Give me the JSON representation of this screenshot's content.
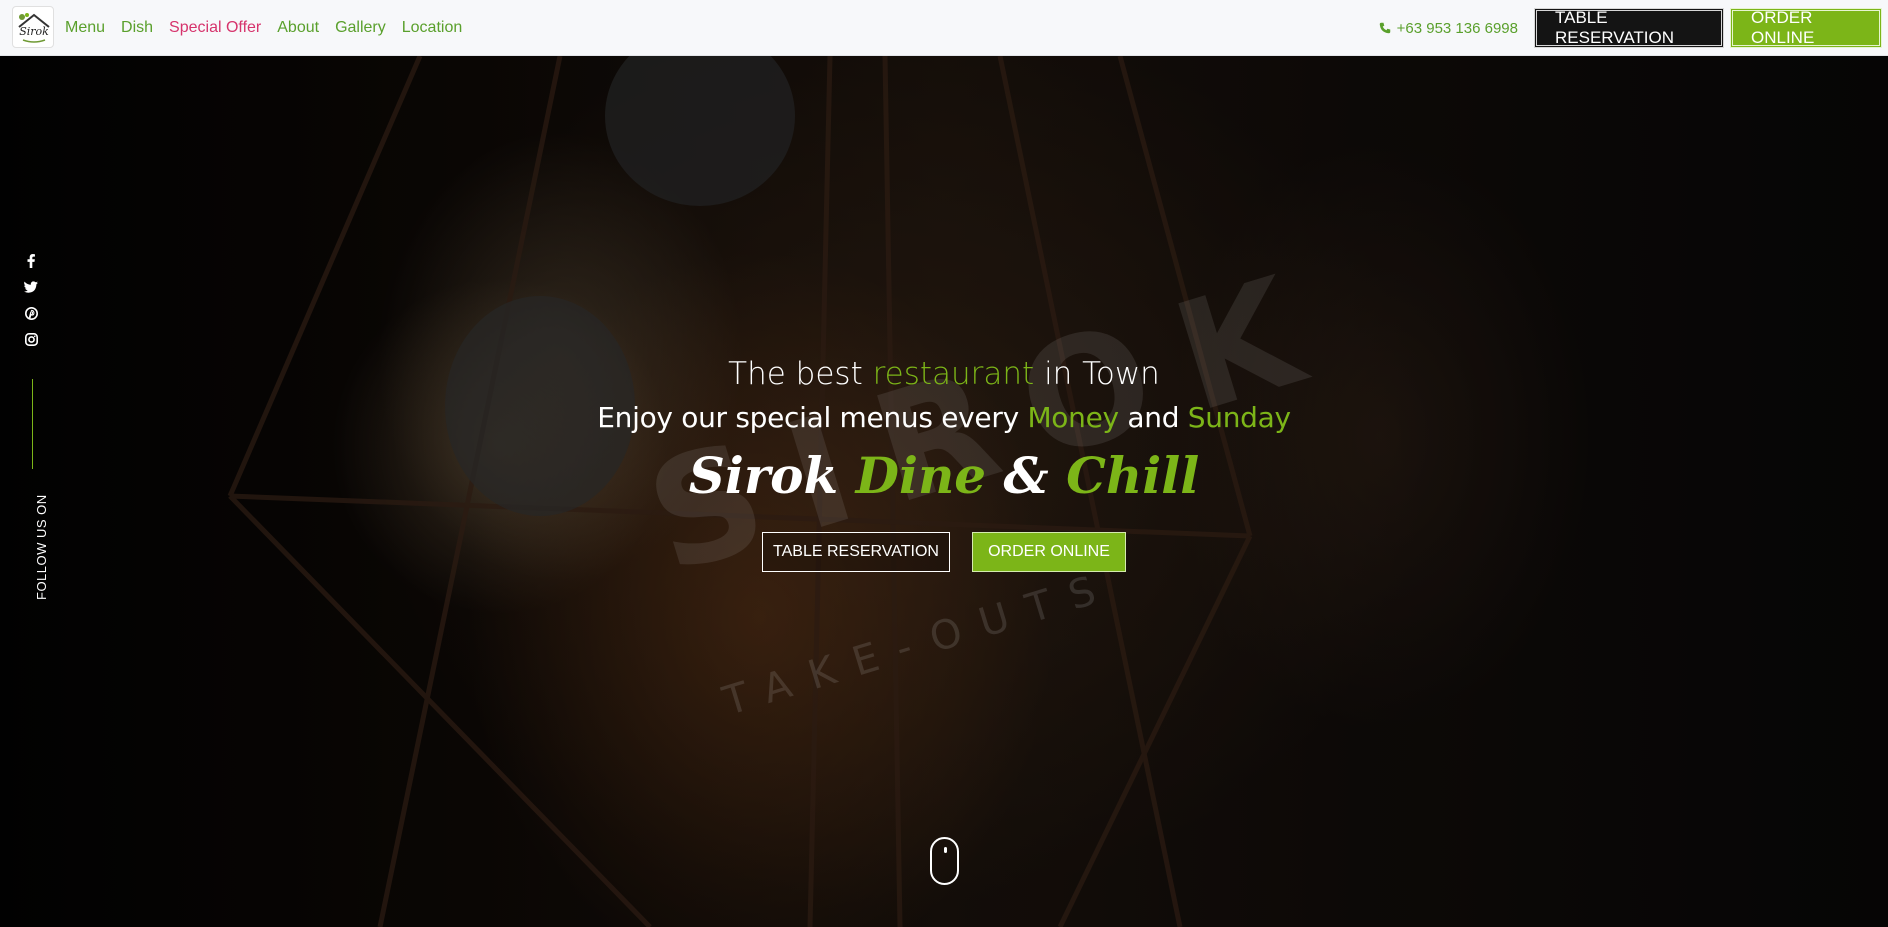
{
  "brand": {
    "logo_label": "Sirok"
  },
  "nav": {
    "items": [
      {
        "label": "Menu",
        "style": "default"
      },
      {
        "label": "Dish",
        "style": "default"
      },
      {
        "label": "Special Offer",
        "style": "special"
      },
      {
        "label": "About",
        "style": "default"
      },
      {
        "label": "Gallery",
        "style": "default"
      },
      {
        "label": "Location",
        "style": "default"
      }
    ],
    "phone": "+63 953 136 6998",
    "reserve_label": "TABLE RESERVATION",
    "order_label": "ORDER ONLINE"
  },
  "hero": {
    "line1_pre": "The best ",
    "line1_accent": "restaurant",
    "line1_post": " in Town",
    "line2_pre": "Enjoy our special menus every ",
    "line2_accent1": "Money",
    "line2_mid": " and ",
    "line2_accent2": "Sunday",
    "brand_word1": "Sirok",
    "brand_word2": "Dine",
    "brand_amp": "&",
    "brand_word3": "Chill",
    "reserve_label": "TABLE RESERVATION",
    "order_label": "ORDER ONLINE",
    "watermark": "SIROK",
    "watermark_sub": "TAKE-OUTS"
  },
  "social": {
    "icons": [
      "facebook-icon",
      "twitter-icon",
      "pinterest-icon",
      "instagram-icon"
    ],
    "follow_text": "FOLLOW US ON"
  },
  "colors": {
    "accent": "#7cb518",
    "nav_link": "#5aa02c",
    "special": "#d6336c",
    "dark_button": "#141414"
  }
}
